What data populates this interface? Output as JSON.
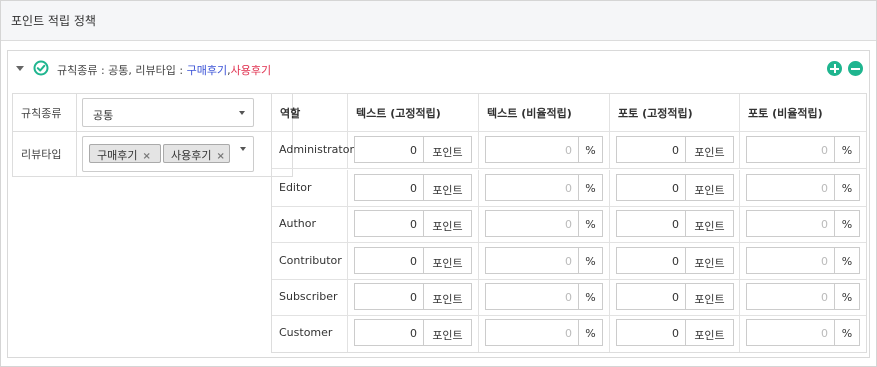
{
  "page": {
    "title": "포인트 적립 정책"
  },
  "rule": {
    "summary_prefix": "규칙종류 : 공통, 리뷰타입 : ",
    "summary_blue": "구매후기",
    "summary_sep": ",",
    "summary_red": "사용후기",
    "colors": {
      "accent": "#1fb58f",
      "blue": "#3a52d6",
      "red": "#e0304f"
    },
    "icons": [
      "chevron-down-icon",
      "check-circle-icon",
      "plus-circle-icon",
      "minus-circle-icon"
    ]
  },
  "left": {
    "rule_type_label": "규칙종류",
    "rule_type_value": "공통",
    "review_type_label": "리뷰타입",
    "review_tags": [
      "구매후기",
      "사용후기"
    ],
    "tag_remove": "×"
  },
  "grid": {
    "headers": [
      "역할",
      "텍스트 (고정적립)",
      "텍스트 (비율적립)",
      "포토 (고정적립)",
      "포토 (비율적립)"
    ],
    "point_suffix": "포인트",
    "percent_suffix": "%",
    "rows": [
      {
        "role": "Administrator",
        "text_fixed": "0",
        "text_rate": "0",
        "photo_fixed": "0",
        "photo_rate": "0"
      },
      {
        "role": "Editor",
        "text_fixed": "0",
        "text_rate": "0",
        "photo_fixed": "0",
        "photo_rate": "0"
      },
      {
        "role": "Author",
        "text_fixed": "0",
        "text_rate": "0",
        "photo_fixed": "0",
        "photo_rate": "0"
      },
      {
        "role": "Contributor",
        "text_fixed": "0",
        "text_rate": "0",
        "photo_fixed": "0",
        "photo_rate": "0"
      },
      {
        "role": "Subscriber",
        "text_fixed": "0",
        "text_rate": "0",
        "photo_fixed": "0",
        "photo_rate": "0"
      },
      {
        "role": "Customer",
        "text_fixed": "0",
        "text_rate": "0",
        "photo_fixed": "0",
        "photo_rate": "0"
      }
    ]
  }
}
